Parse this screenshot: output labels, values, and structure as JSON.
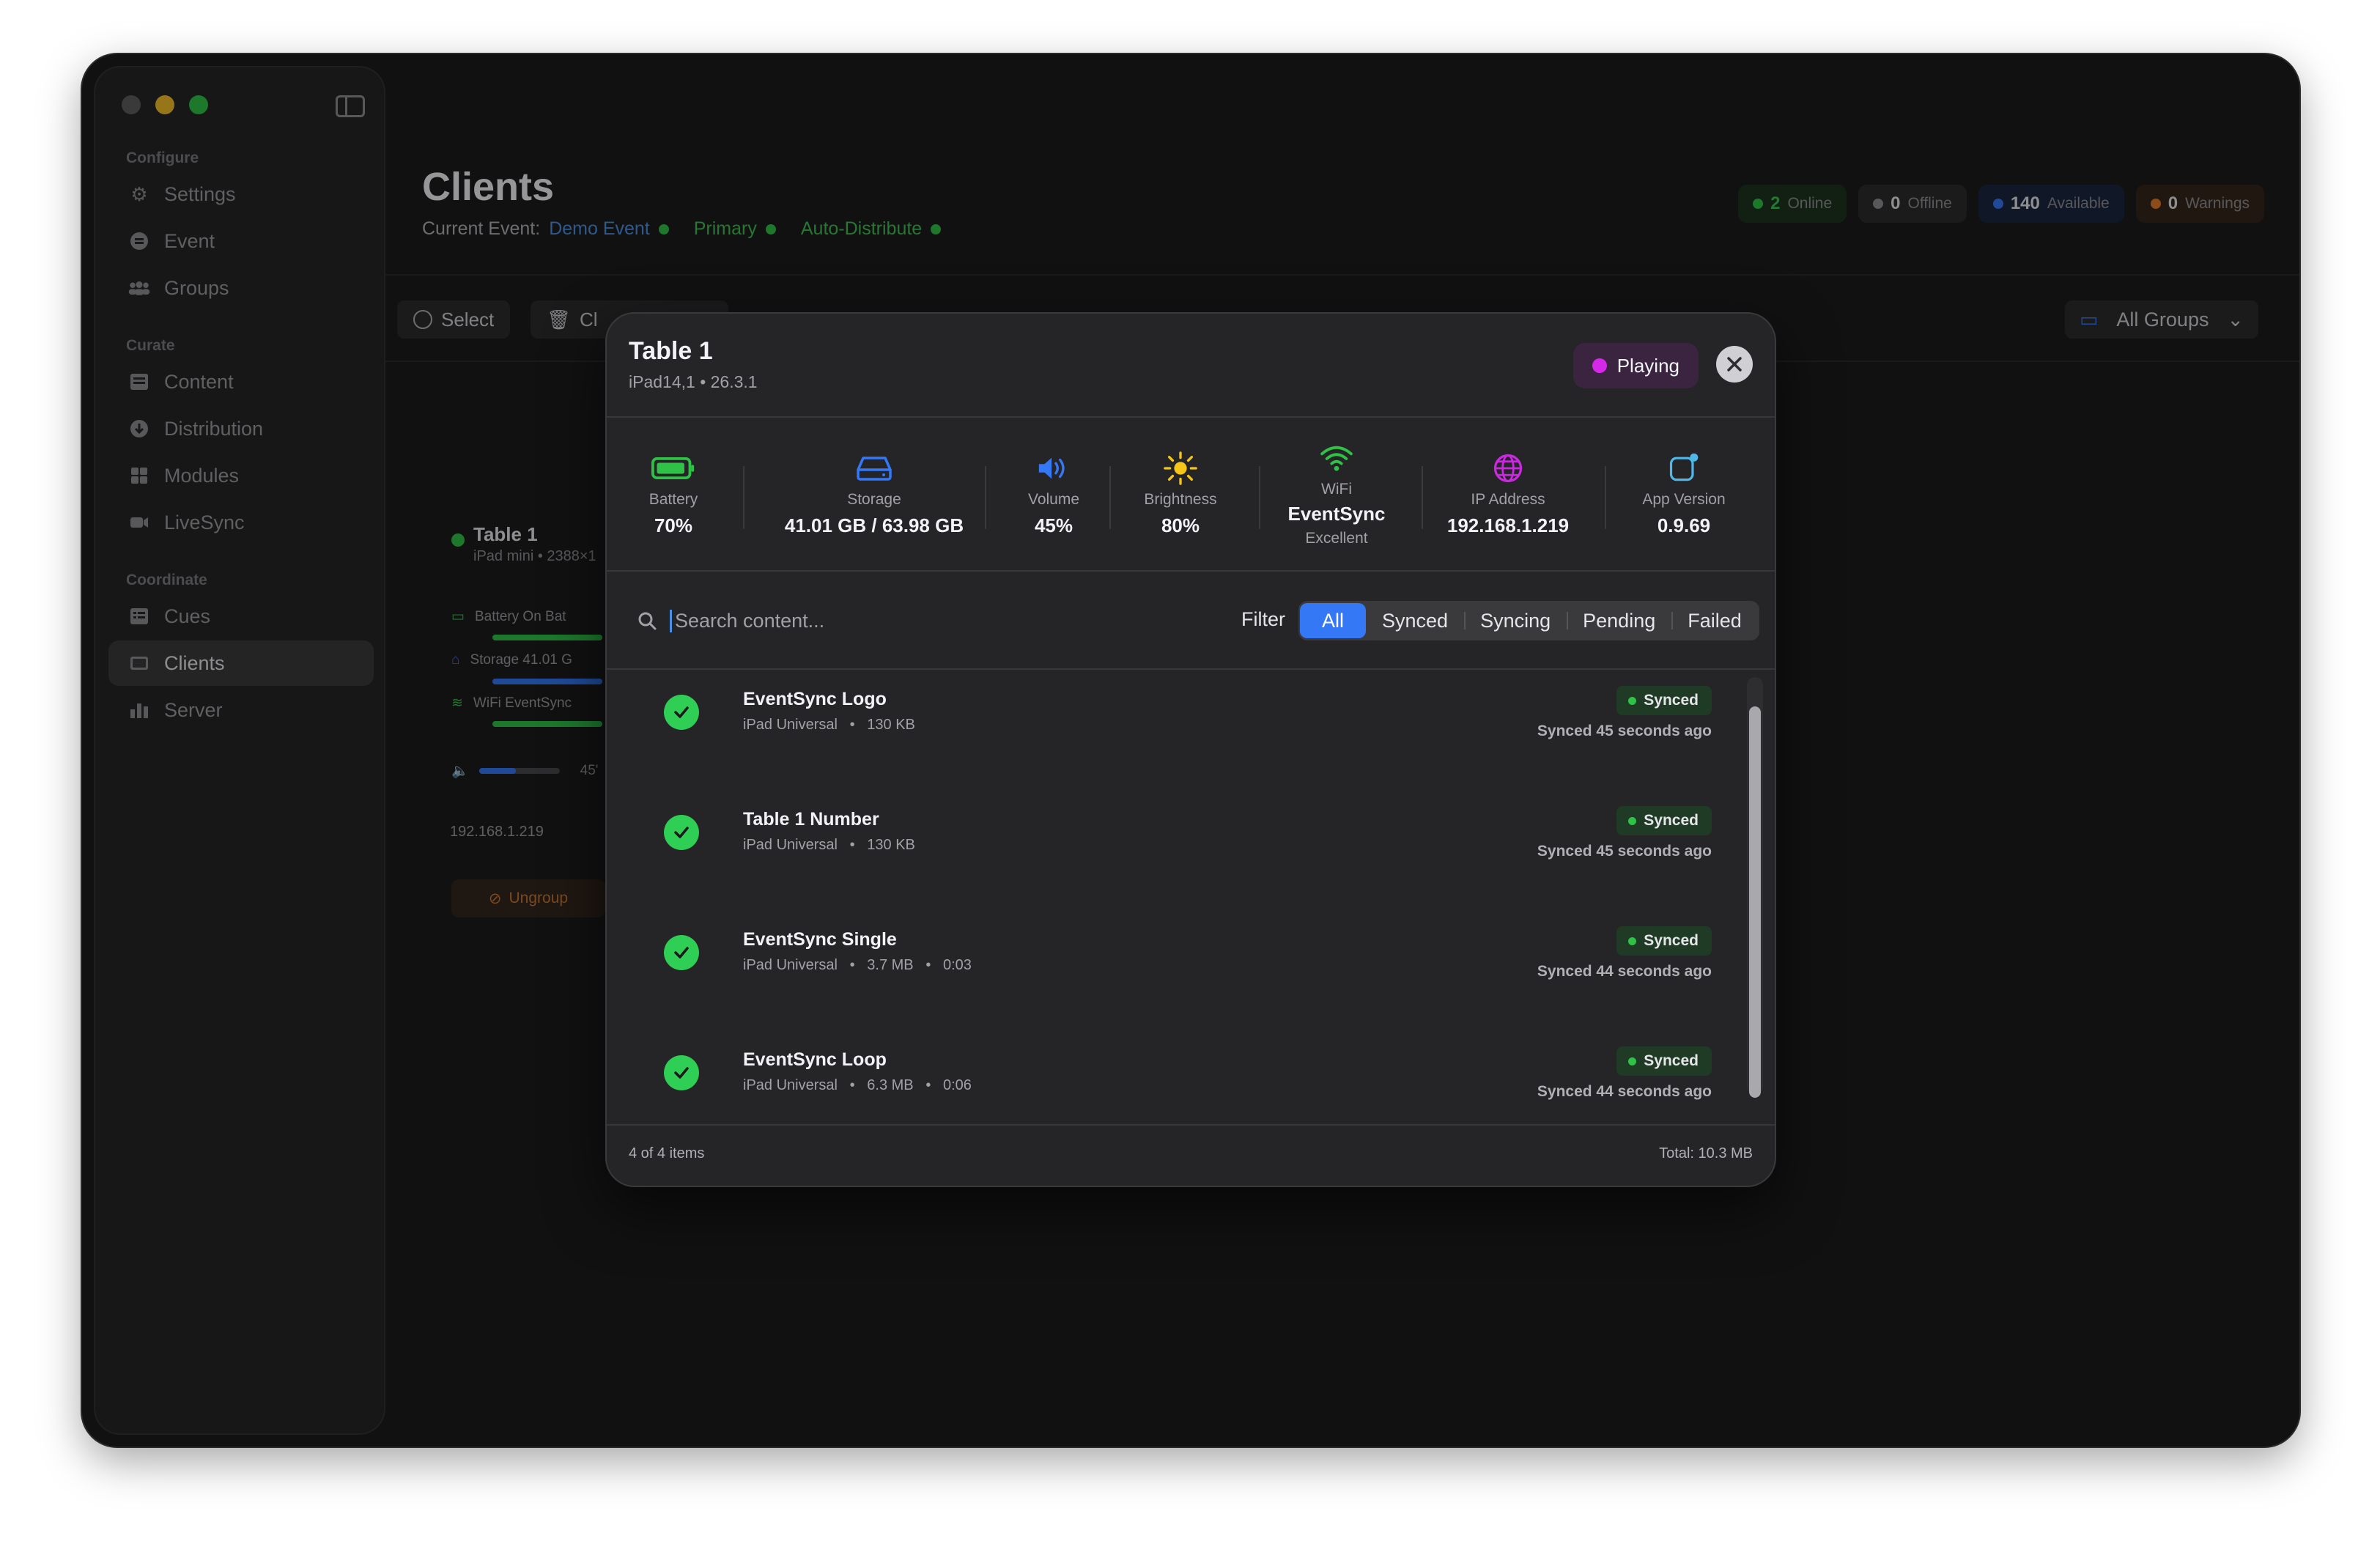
{
  "window": {
    "sidebar": {
      "sections": [
        {
          "title": "Configure",
          "items": [
            {
              "label": "Settings",
              "icon": "gear-icon"
            },
            {
              "label": "Event",
              "icon": "event-icon"
            },
            {
              "label": "Groups",
              "icon": "groups-icon"
            }
          ]
        },
        {
          "title": "Curate",
          "items": [
            {
              "label": "Content",
              "icon": "content-icon"
            },
            {
              "label": "Distribution",
              "icon": "distribution-icon"
            },
            {
              "label": "Modules",
              "icon": "modules-icon"
            },
            {
              "label": "LiveSync",
              "icon": "camera-icon"
            }
          ]
        },
        {
          "title": "Coordinate",
          "items": [
            {
              "label": "Cues",
              "icon": "cues-icon"
            },
            {
              "label": "Clients",
              "icon": "clients-icon",
              "active": true
            },
            {
              "label": "Server",
              "icon": "server-icon"
            }
          ]
        }
      ]
    }
  },
  "header": {
    "title": "Clients",
    "current_event_label": "Current Event:",
    "event_name": "Demo Event",
    "primary": "Primary",
    "auto_distribute": "Auto-Distribute",
    "stats": [
      {
        "count": "2",
        "label": "Online",
        "color": "#30c247"
      },
      {
        "count": "0",
        "label": "Offline",
        "color": "#8e8e93"
      },
      {
        "count": "140",
        "label": "Available",
        "color": "#3478f6"
      },
      {
        "count": "0",
        "label": "Warnings",
        "color": "#e07b2a"
      }
    ]
  },
  "toolbar": {
    "select_label": "Select",
    "clear_label": "Cl",
    "groups_label": "All Groups"
  },
  "background_card": {
    "title": "Table 1",
    "subtitle": "iPad mini • 2388×1",
    "battery": "Battery  On Bat",
    "storage": "Storage  41.01 G",
    "wifi": "WiFi  EventSync",
    "volume_value": "45'",
    "ip": "192.168.1.219",
    "ungroup_label": "Ungroup"
  },
  "modal": {
    "title": "Table 1",
    "subtitle": "iPad14,1 • 26.3.1",
    "status": "Playing",
    "status_color": "#d628e8",
    "metrics": [
      {
        "label": "Battery",
        "value": "70%",
        "icon": "battery-icon"
      },
      {
        "label": "Storage",
        "value": "41.01 GB / 63.98 GB",
        "icon": "storage-icon"
      },
      {
        "label": "Volume",
        "value": "45%",
        "icon": "speaker-icon"
      },
      {
        "label": "Brightness",
        "value": "80%",
        "icon": "sun-icon"
      },
      {
        "label": "WiFi",
        "value": "EventSync",
        "sub": "Excellent",
        "icon": "wifi-icon"
      },
      {
        "label": "IP Address",
        "value": "192.168.1.219",
        "icon": "globe-icon"
      },
      {
        "label": "App Version",
        "value": "0.9.69",
        "icon": "app-update-icon"
      }
    ],
    "search_placeholder": "Search content...",
    "filter_label": "Filter",
    "filters": [
      "All",
      "Synced",
      "Syncing",
      "Pending",
      "Failed"
    ],
    "selected_filter": "All",
    "items": [
      {
        "name": "EventSync Logo",
        "meta": "iPad Universal   •   130 KB",
        "status": "Synced",
        "synced_at": "Synced 45 seconds ago"
      },
      {
        "name": "Table 1 Number",
        "meta": "iPad Universal   •   130 KB",
        "status": "Synced",
        "synced_at": "Synced 45 seconds ago"
      },
      {
        "name": "EventSync Single",
        "meta": "iPad Universal   •   3.7 MB   •   0:03",
        "status": "Synced",
        "synced_at": "Synced 44 seconds ago"
      },
      {
        "name": "EventSync Loop",
        "meta": "iPad Universal   •   6.3 MB   •   0:06",
        "status": "Synced",
        "synced_at": "Synced 44 seconds ago"
      }
    ],
    "footer_count": "4 of 4 items",
    "footer_total": "Total: 10.3 MB"
  }
}
